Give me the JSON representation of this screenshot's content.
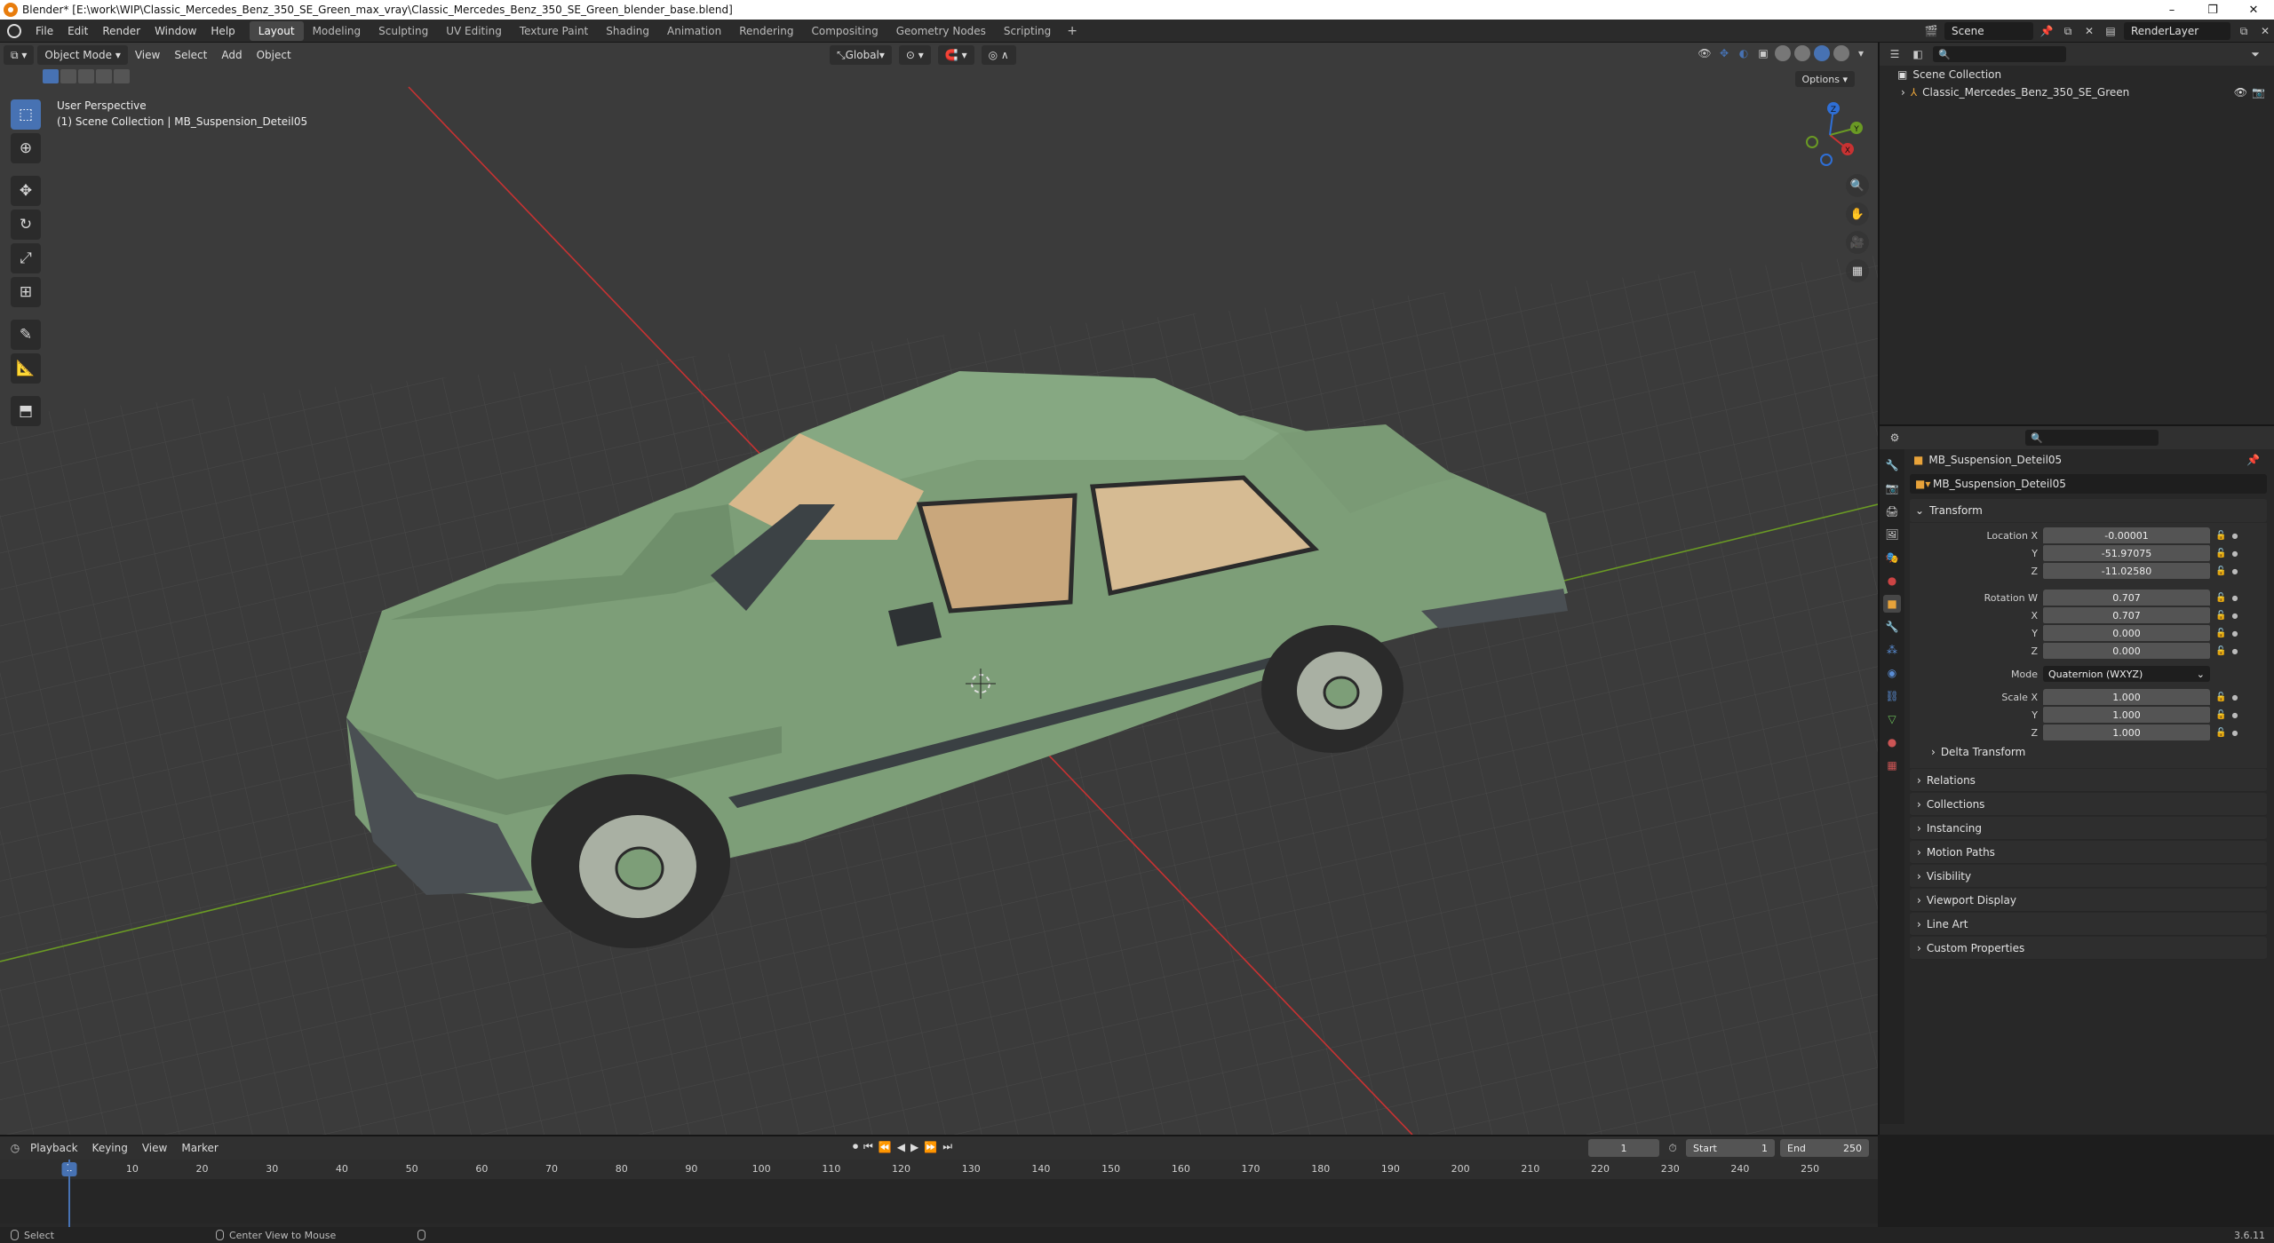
{
  "window": {
    "title": "Blender* [E:\\work\\WIP\\Classic_Mercedes_Benz_350_SE_Green_max_vray\\Classic_Mercedes_Benz_350_SE_Green_blender_base.blend]",
    "controls": [
      "–",
      "❐",
      "✕"
    ]
  },
  "menu": [
    "File",
    "Edit",
    "Render",
    "Window",
    "Help"
  ],
  "workspaces": [
    "Layout",
    "Modeling",
    "Sculpting",
    "UV Editing",
    "Texture Paint",
    "Shading",
    "Animation",
    "Rendering",
    "Compositing",
    "Geometry Nodes",
    "Scripting"
  ],
  "scene": {
    "name": "Scene",
    "view_layer": "RenderLayer"
  },
  "viewport": {
    "mode": "Object Mode",
    "menus": [
      "View",
      "Select",
      "Add",
      "Object"
    ],
    "orientation": "Global",
    "options_label": "Options",
    "info_line1": "User Perspective",
    "info_line2": "(1) Scene Collection | MB_Suspension_Deteil05",
    "gizmo": {
      "x": "X",
      "y": "Y",
      "z": "Z"
    }
  },
  "outliner": {
    "root": "Scene Collection",
    "items": [
      "Classic_Mercedes_Benz_350_SE_Green"
    ]
  },
  "properties": {
    "object_name": "MB_Suspension_Deteil05",
    "datablock": "MB_Suspension_Deteil05",
    "transform": {
      "header": "Transform",
      "location_label": "Location X",
      "location": {
        "x": "-0.00001",
        "y": "-51.97075",
        "z": "-11.02580"
      },
      "rotation_label": "Rotation W",
      "rotation": {
        "w": "0.707",
        "x": "0.707",
        "y": "0.000",
        "z": "0.000"
      },
      "mode_label": "Mode",
      "mode_value": "Quaternion (WXYZ)",
      "scale_label": "Scale X",
      "scale": {
        "x": "1.000",
        "y": "1.000",
        "z": "1.000"
      },
      "axis_y": "Y",
      "axis_z": "Z",
      "axis_x": "X",
      "delta": "Delta Transform"
    },
    "panels": [
      "Relations",
      "Collections",
      "Instancing",
      "Motion Paths",
      "Visibility",
      "Viewport Display",
      "Line Art",
      "Custom Properties"
    ]
  },
  "timeline": {
    "menus": [
      "Playback",
      "Keying",
      "View",
      "Marker"
    ],
    "current_frame": "1",
    "start_label": "Start",
    "start": "1",
    "end_label": "End",
    "end": "250",
    "ticks": [
      "10",
      "20",
      "30",
      "40",
      "50",
      "60",
      "70",
      "80",
      "90",
      "100",
      "110",
      "120",
      "130",
      "140",
      "150",
      "160",
      "170",
      "180",
      "190",
      "200",
      "210",
      "220",
      "230",
      "240",
      "250"
    ]
  },
  "status": {
    "left": "Select",
    "middle": "Center View to Mouse",
    "version": "3.6.11"
  },
  "colors": {
    "accent": "#4772b3",
    "car_body": "#7d9e78",
    "interior": "#d8b88c",
    "x_axis": "#c83232",
    "y_axis": "#6a9a24"
  }
}
